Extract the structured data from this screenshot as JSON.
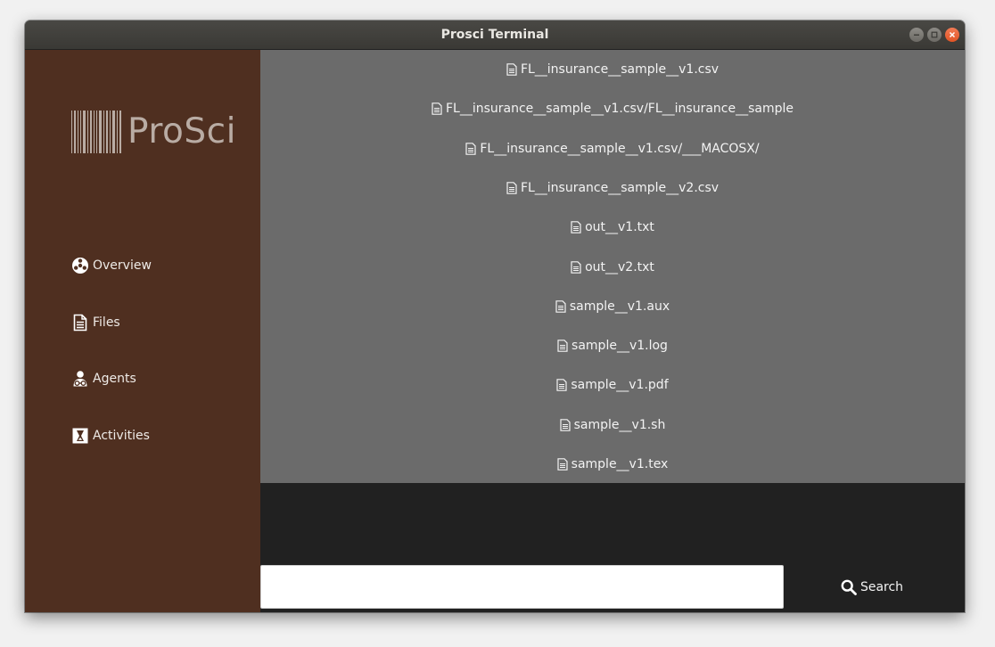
{
  "window": {
    "title": "Prosci Terminal"
  },
  "sidebar": {
    "logo_text": "ProSci",
    "items": [
      {
        "label": "Overview",
        "icon": "overview-icon"
      },
      {
        "label": "Files",
        "icon": "file-icon"
      },
      {
        "label": "Agents",
        "icon": "agents-icon"
      },
      {
        "label": "Activities",
        "icon": "activities-icon"
      }
    ]
  },
  "files": [
    "FL__insurance__sample__v1.csv",
    "FL__insurance__sample__v1.csv/FL__insurance__sample",
    "FL__insurance__sample__v1.csv/___MACOSX/",
    "FL__insurance__sample__v2.csv",
    "out__v1.txt",
    "out__v2.txt",
    "sample__v1.aux",
    "sample__v1.log",
    "sample__v1.pdf",
    "sample__v1.sh",
    "sample__v1.tex"
  ],
  "search": {
    "value": "",
    "button_label": "Search"
  },
  "colors": {
    "sidebar_bg": "#4f2f20",
    "file_panel_bg": "#6b6b6b",
    "console_bg": "#212121",
    "close_button": "#e25424"
  }
}
